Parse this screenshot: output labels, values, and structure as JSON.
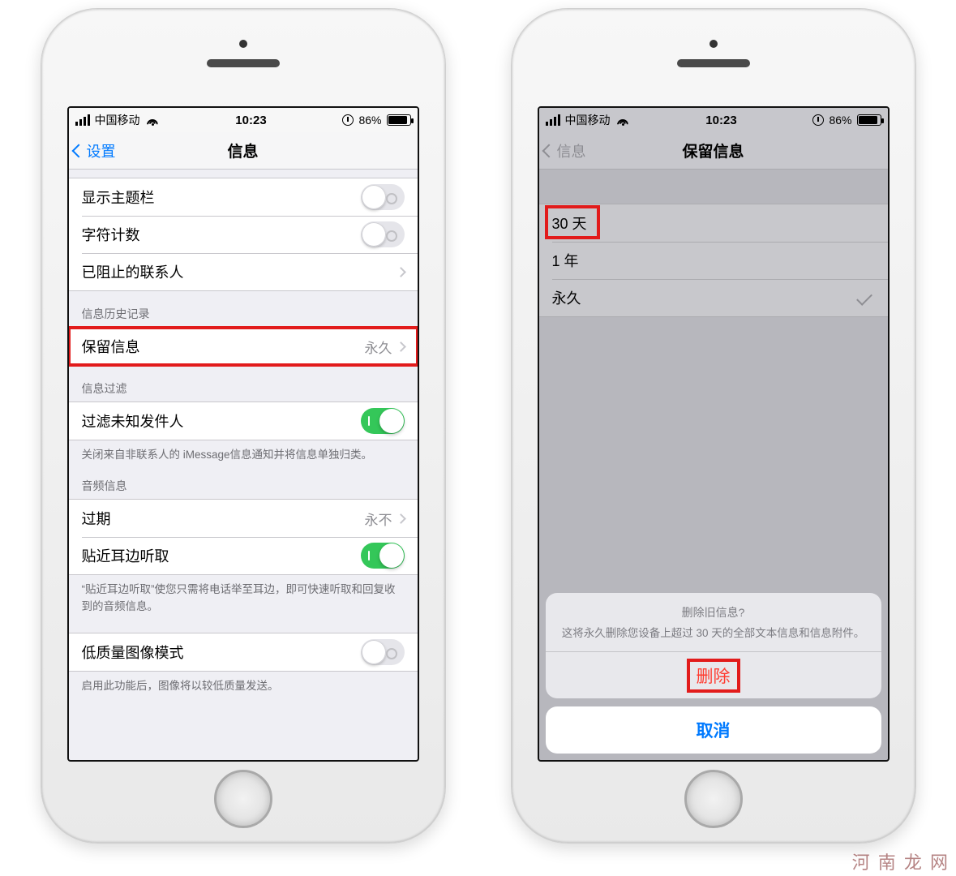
{
  "status": {
    "carrier": "中国移动",
    "time": "10:23",
    "battery_pct": "86%"
  },
  "left": {
    "nav": {
      "back": "设置",
      "title": "信息"
    },
    "rows": {
      "show_subject": "显示主题栏",
      "char_count": "字符计数",
      "blocked_contacts": "已阻止的联系人",
      "history_header": "信息历史记录",
      "keep_messages_label": "保留信息",
      "keep_messages_value": "永久",
      "filter_header": "信息过滤",
      "filter_unknown": "过滤未知发件人",
      "filter_note": "关闭来自非联系人的 iMessage信息通知并将信息单独归类。",
      "audio_header": "音频信息",
      "expire_label": "过期",
      "expire_value": "永不",
      "raise_listen": "贴近耳边听取",
      "raise_note": "“贴近耳边听取”使您只需将电话举至耳边，即可快速听取和回复收到的音频信息。",
      "low_quality": "低质量图像模式",
      "low_quality_note": "启用此功能后，图像将以较低质量发送。"
    }
  },
  "right": {
    "nav": {
      "back": "信息",
      "title": "保留信息"
    },
    "options": {
      "opt30": "30 天",
      "opt1y": "1 年",
      "optForever": "永久"
    },
    "sheet": {
      "title": "删除旧信息?",
      "message": "这将永久删除您设备上超过 30 天的全部文本信息和信息附件。",
      "delete": "删除",
      "cancel": "取消"
    }
  },
  "watermark": "河 南 龙 网"
}
